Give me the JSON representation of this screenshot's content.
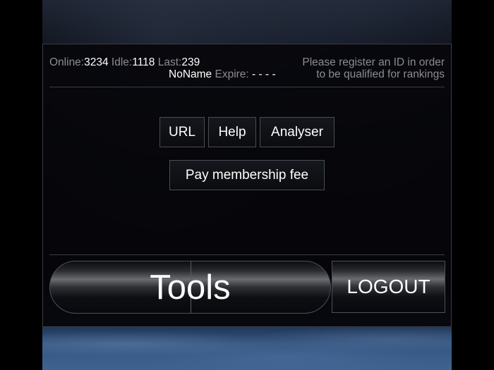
{
  "status": {
    "online_label": "Online:",
    "online_value": "3234",
    "idle_label": "Idle:",
    "idle_value": "1118",
    "last_label": "Last:",
    "last_value": "239",
    "user_name": "NoName",
    "expire_label": "Expire:",
    "expire_value": "- - - -",
    "register_line1": "Please register an ID in order",
    "register_line2": "to be qualified for rankings"
  },
  "buttons": {
    "url": "URL",
    "help": "Help",
    "analyser": "Analyser",
    "pay": "Pay membership fee"
  },
  "footer": {
    "tools": "Tools",
    "logout": "LOGOUT"
  }
}
